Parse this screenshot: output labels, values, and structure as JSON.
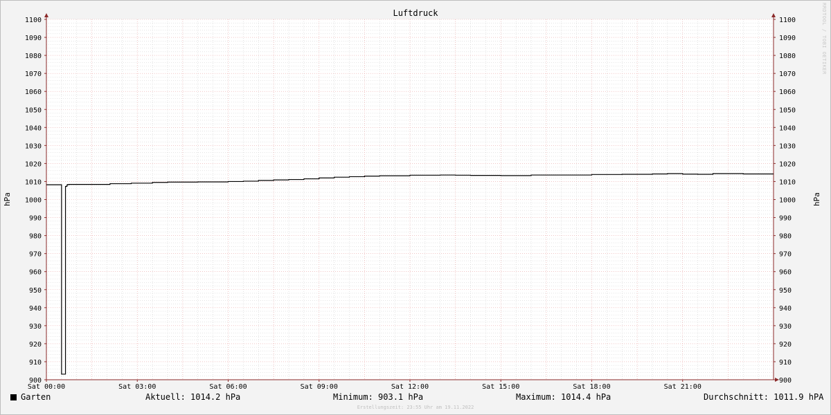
{
  "chart_data": {
    "type": "line",
    "title": "Luftdruck",
    "ylabel": "hPa",
    "ylim": [
      900,
      1100
    ],
    "yticks": [
      900,
      910,
      920,
      930,
      940,
      950,
      960,
      970,
      980,
      990,
      1000,
      1010,
      1020,
      1030,
      1040,
      1050,
      1060,
      1070,
      1080,
      1090,
      1100
    ],
    "xlim_hours": [
      0,
      24
    ],
    "xticks": [
      {
        "label": "Sat 00:00",
        "hour": 0
      },
      {
        "label": "Sat 03:00",
        "hour": 3
      },
      {
        "label": "Sat 06:00",
        "hour": 6
      },
      {
        "label": "Sat 09:00",
        "hour": 9
      },
      {
        "label": "Sat 12:00",
        "hour": 12
      },
      {
        "label": "Sat 15:00",
        "hour": 15
      },
      {
        "label": "Sat 18:00",
        "hour": 18
      },
      {
        "label": "Sat 21:00",
        "hour": 21
      }
    ],
    "grid": true,
    "series": [
      {
        "name": "Garten",
        "color": "#000000",
        "x_hours": [
          0,
          0.45,
          0.5,
          0.5,
          0.55,
          0.6,
          0.63,
          0.68,
          0.7,
          0.75,
          2.1,
          2.8,
          3.5,
          4.0,
          5.0,
          6.0,
          6.5,
          7.0,
          7.5,
          8.0,
          8.5,
          9.0,
          9.5,
          10.0,
          10.5,
          11.0,
          12.0,
          13.0,
          13.5,
          14.0,
          15.0,
          16.0,
          17.0,
          18.0,
          19.0,
          20.0,
          20.5,
          21.0,
          21.5,
          22.0,
          22.5,
          23.0,
          24.0
        ],
        "values": [
          1008.2,
          1008.2,
          1008.2,
          903.1,
          903.1,
          903.1,
          1007.3,
          1008.1,
          1008.3,
          1008.4,
          1008.8,
          1009.1,
          1009.5,
          1009.7,
          1009.8,
          1010.0,
          1010.2,
          1010.6,
          1010.9,
          1011.1,
          1011.5,
          1012.0,
          1012.4,
          1012.7,
          1013.0,
          1013.2,
          1013.5,
          1013.6,
          1013.5,
          1013.4,
          1013.3,
          1013.6,
          1013.6,
          1013.9,
          1014.0,
          1014.2,
          1014.4,
          1014.1,
          1014.0,
          1014.4,
          1014.4,
          1014.2,
          1014.2
        ]
      }
    ]
  },
  "legend": {
    "series_name": "Garten",
    "current": "Aktuell: 1014.2 hPa",
    "minimum": "Minimum: 903.1 hPa",
    "maximum": "Maximum: 1014.4 hPa",
    "average": "Durchschnitt: 1011.9 hPA"
  },
  "watermark": "RRDTOOL / TOBI OETIKER",
  "footer": "Erstellungszeit: 23:55 Uhr am 19.11.2022",
  "colors": {
    "background": "#f3f3f3",
    "plot_background": "#ffffff",
    "minor_grid": "#c8c8c8",
    "major_grid": "#e8a0a0",
    "axis": "#8b2a2a",
    "line": "#000000"
  }
}
